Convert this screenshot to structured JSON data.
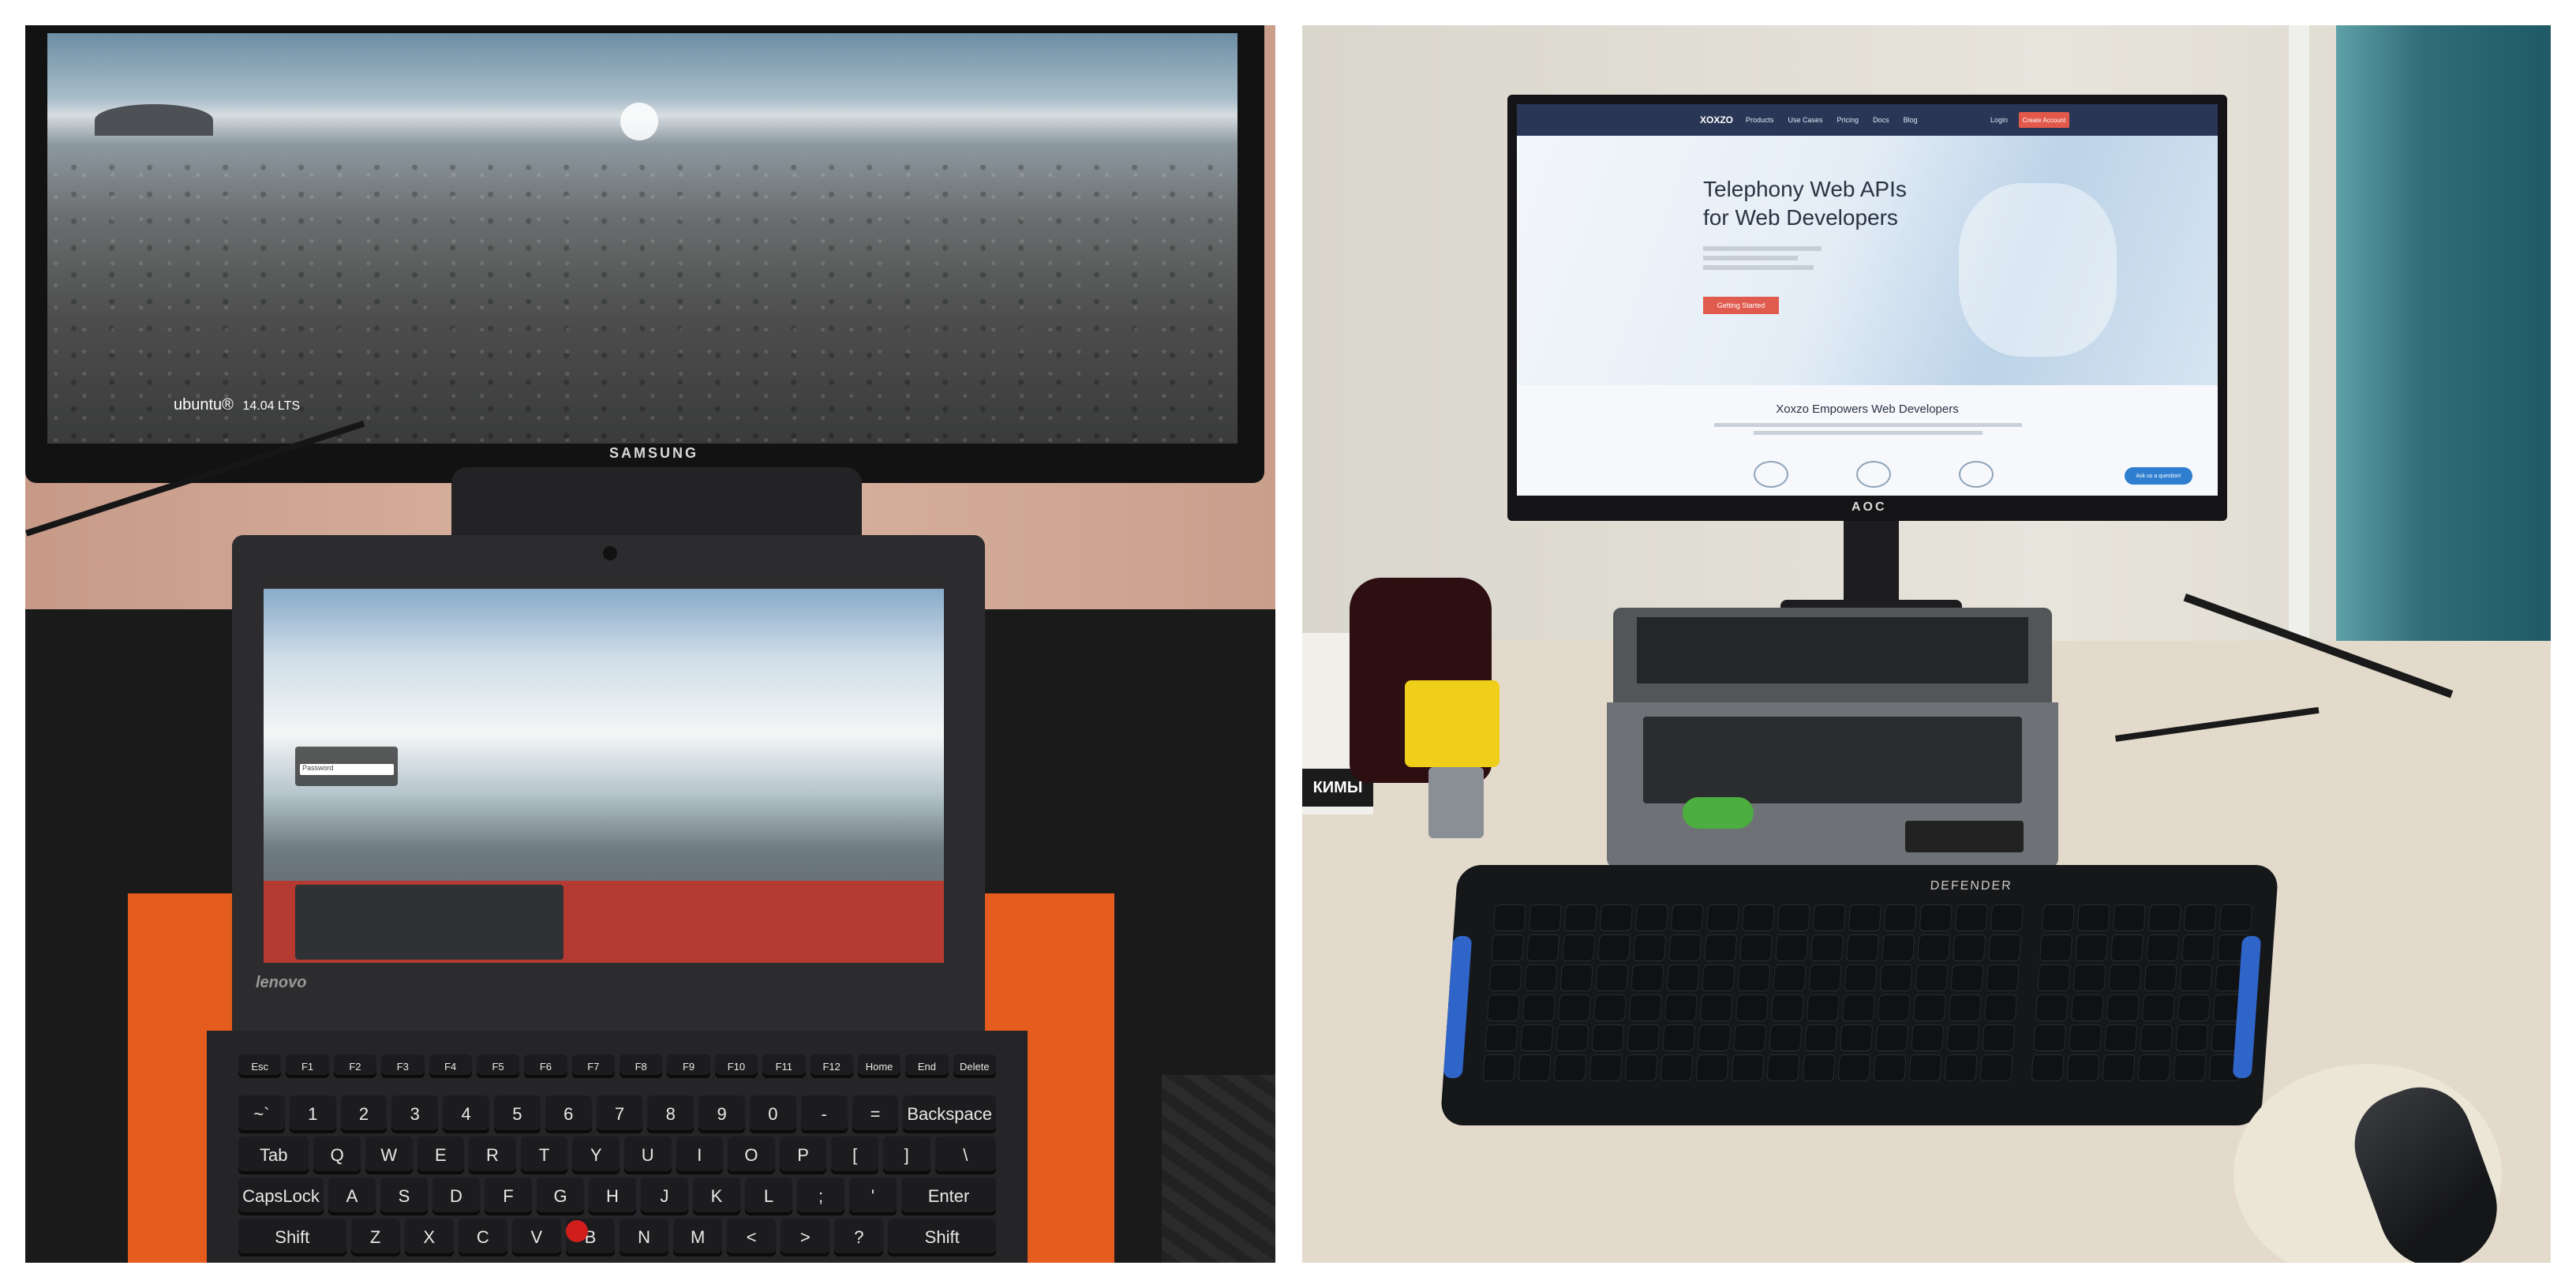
{
  "left_photo": {
    "samsung_monitor": {
      "brand": "SAMSUNG",
      "os_label": "ubuntu",
      "os_version": "14.04 LTS"
    },
    "laptop": {
      "brand": "lenovo",
      "login_field": "Password",
      "keyboard_rows": [
        [
          "Esc",
          "F1",
          "F2",
          "F3",
          "F4",
          "F5",
          "F6",
          "F7",
          "F8",
          "F9",
          "F10",
          "F11",
          "F12",
          "Home",
          "End",
          "Delete"
        ],
        [
          "~`",
          "1",
          "2",
          "3",
          "4",
          "5",
          "6",
          "7",
          "8",
          "9",
          "0",
          "-",
          "=",
          "Backspace"
        ],
        [
          "Tab",
          "Q",
          "W",
          "E",
          "R",
          "T",
          "Y",
          "U",
          "I",
          "O",
          "P",
          "[",
          "]",
          "\\"
        ],
        [
          "CapsLock",
          "A",
          "S",
          "D",
          "F",
          "G",
          "H",
          "J",
          "K",
          "L",
          ";",
          "'",
          "Enter"
        ],
        [
          "Shift",
          "Z",
          "X",
          "C",
          "V",
          "B",
          "N",
          "M",
          "<",
          ">",
          "?",
          "Shift"
        ]
      ]
    }
  },
  "right_photo": {
    "aoc_monitor": {
      "brand": "AOC",
      "website": {
        "logo": "XOXZO",
        "nav_items": [
          "Products",
          "Use Cases",
          "Pricing",
          "Docs",
          "Blog"
        ],
        "top_links": [
          "Login",
          "Create Account"
        ],
        "hero_title_line1": "Telephony Web APIs",
        "hero_title_line2": "for Web Developers",
        "cta_button": "Getting Started",
        "section_title": "Xoxzo Empowers Web Developers",
        "chat_button": "Ask us a question!"
      }
    },
    "box_label": "КИМЫ",
    "keyboard_brand": "DEFENDER"
  }
}
